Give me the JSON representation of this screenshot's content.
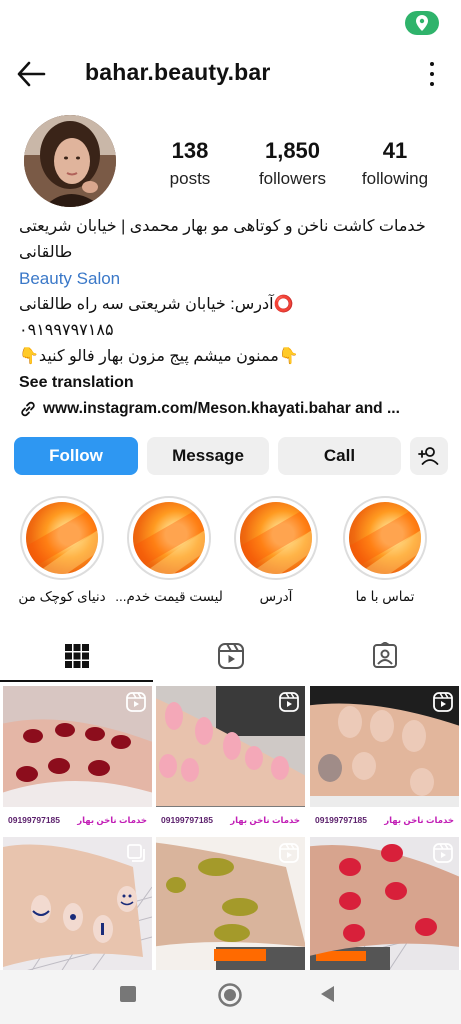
{
  "colors": {
    "accent": "#2e97f2",
    "link": "#3a78c8",
    "location_pill": "#2fb36b"
  },
  "status_bar": {
    "location_icon": "location-pin-icon"
  },
  "header": {
    "username": "bahar.beauty.bar",
    "back_icon": "arrow-left-icon",
    "menu_icon": "more-vertical-icon"
  },
  "profile": {
    "stats": [
      {
        "value": "138",
        "label": "posts"
      },
      {
        "value": "1,850",
        "label": "followers"
      },
      {
        "value": "41",
        "label": "following"
      }
    ],
    "bio_lines": [
      "خدمات کاشت ناخن و کوتاهی مو بهار محمدی | خیابان شریعتی",
      "طالقانی"
    ],
    "category": "Beauty Salon",
    "address_line": "⭕آدرس: خیابان شریعتی سه راه طالقانی",
    "phone": "۰۹۱۹۹۷۹۷۱۸۵",
    "follow_line": "👇ممنون میشم پیج مزون بهار فالو کنید👇",
    "see_translation": "See translation",
    "link": "www.instagram.com/Meson.khayati.bahar and ..."
  },
  "actions": {
    "follow": "Follow",
    "message": "Message",
    "call": "Call",
    "suggest_icon": "add-person-icon"
  },
  "highlights": [
    {
      "label": "تماس با ما"
    },
    {
      "label": "آدرس"
    },
    {
      "label": "لیست قیمت خدم..."
    },
    {
      "label": "دنیای کوچک من"
    }
  ],
  "tabs": [
    {
      "name": "grid",
      "icon": "grid-icon",
      "active": true
    },
    {
      "name": "reels",
      "icon": "reels-icon",
      "active": false
    },
    {
      "name": "tagged",
      "icon": "tagged-person-icon",
      "active": false
    }
  ],
  "posts": {
    "banner_phone": "09199797185",
    "banner_service": "خدمات ناخن بهار"
  },
  "system_nav": {
    "recents": "square-icon",
    "home": "circle-icon",
    "back": "triangle-back-icon"
  }
}
